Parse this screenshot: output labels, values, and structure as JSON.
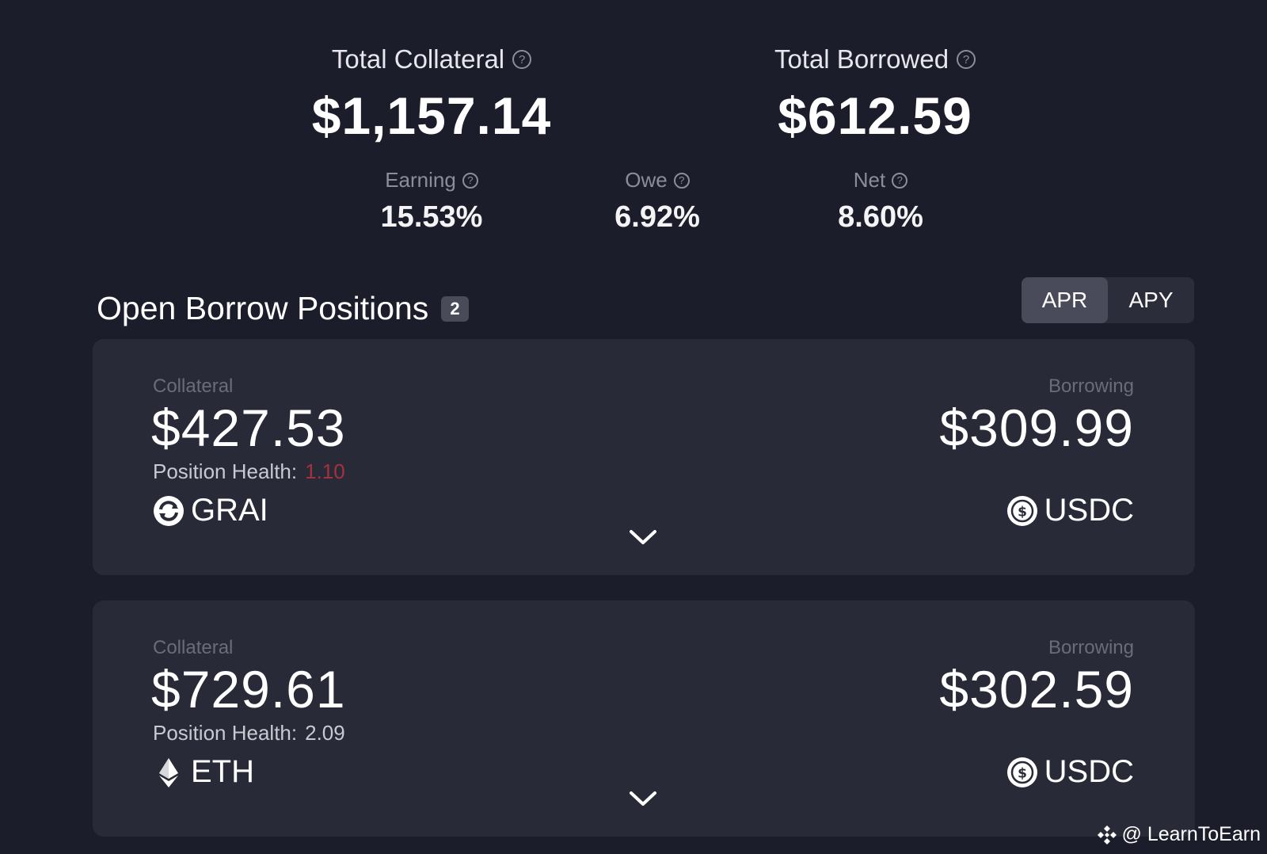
{
  "summary": {
    "total_collateral": {
      "label": "Total Collateral",
      "value": "$1,157.14"
    },
    "total_borrowed": {
      "label": "Total Borrowed",
      "value": "$612.59"
    },
    "earning": {
      "label": "Earning",
      "value": "15.53%"
    },
    "owe": {
      "label": "Owe",
      "value": "6.92%"
    },
    "net": {
      "label": "Net",
      "value": "8.60%"
    },
    "help_glyph": "?"
  },
  "section": {
    "title": "Open Borrow Positions",
    "count": "2"
  },
  "rate_toggle": {
    "options": [
      "APR",
      "APY"
    ],
    "selected": "APR"
  },
  "positions": [
    {
      "collateral_label": "Collateral",
      "collateral_value": "$427.53",
      "health_label": "Position Health:",
      "health_value": "1.10",
      "health_status": "at-risk",
      "collateral_asset": "GRAI",
      "collateral_asset_icon": "grai-icon",
      "borrowing_label": "Borrowing",
      "borrowing_value": "$309.99",
      "borrowing_asset": "USDC",
      "borrowing_asset_icon": "usdc-icon"
    },
    {
      "collateral_label": "Collateral",
      "collateral_value": "$729.61",
      "health_label": "Position Health:",
      "health_value": "2.09",
      "health_status": "healthy",
      "collateral_asset": "ETH",
      "collateral_asset_icon": "eth-icon",
      "borrowing_label": "Borrowing",
      "borrowing_value": "$302.59",
      "borrowing_asset": "USDC",
      "borrowing_asset_icon": "usdc-icon"
    }
  ],
  "watermark": {
    "text": "@ LearnToEarn",
    "icon": "binance-logo-icon"
  },
  "colors": {
    "background": "#1c1d2a",
    "card": "#292a38",
    "toggle_active": "#4a4b5a",
    "health_risk": "#a3323e",
    "muted_label": "#6b6c7a"
  }
}
